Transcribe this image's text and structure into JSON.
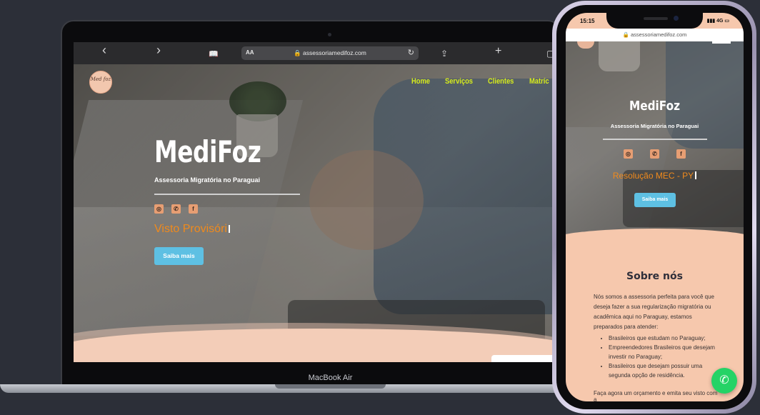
{
  "laptop": {
    "brand": "MacBook Air",
    "browser": {
      "back_icon": "‹",
      "forward_icon": "›",
      "bookmarks_icon": "📖",
      "reader_label": "AA",
      "url": "🔒 assessoriamedifoz.com",
      "reload_icon": "↻",
      "share_icon": "⇪",
      "new_tab_icon": "+",
      "tabs_icon": "▢"
    },
    "site": {
      "logo_text": "Med foz",
      "nav": [
        "Home",
        "Serviços",
        "Clientes",
        "Matríc"
      ],
      "title": "MediFoz",
      "subtitle": "Assessoria Migratória no Paraguai",
      "social_icons": [
        "instagram-icon",
        "whatsapp-icon",
        "facebook-icon"
      ],
      "typed_text": "Visto Provisóri",
      "cta": "Saiba mais"
    }
  },
  "phone": {
    "status_time": "15:15",
    "status_right": "▮▮▮ 4G ▭",
    "url": "🔒 assessoriamedifoz.com",
    "site": {
      "title": "MediFoz",
      "subtitle": "Assessoria Migratória no Paraguai",
      "typed_text": "Resolução MEC - PY",
      "cta": "Saiba mais",
      "about_title": "Sobre nós",
      "about_text": "Nós somos a assessoria perfeita para você que deseja fazer a sua regularização migratória ou acadêmica aqui no Paraguay, estamos preparados para atender:",
      "about_list": [
        "Brasileiros que estudam no Paraguay;",
        "Empreendedores Brasileiros que desejam investir no Paraguay;",
        "Brasileiros que desejam possuir uma segunda opção de residência."
      ],
      "cta_text": "Faça agora um orçamento e emita seu visto com a"
    }
  },
  "colors": {
    "accent_nav": "#d7ec1c",
    "typed": "#f08a1c",
    "button": "#5ec0e3",
    "peach": "#f6c8ad",
    "whatsapp": "#25d366"
  }
}
